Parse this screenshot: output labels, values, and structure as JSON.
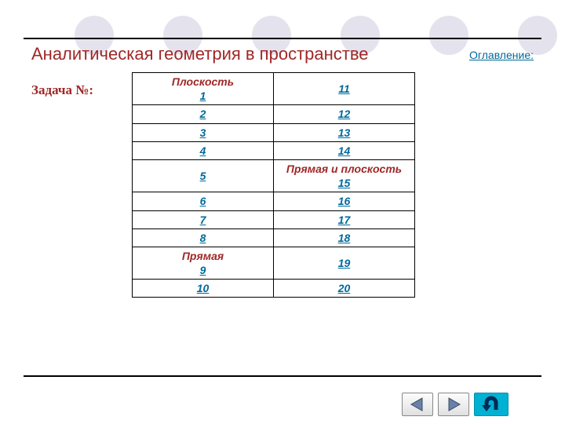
{
  "title": "Аналитическая геометрия в пространстве",
  "toc_link": "Оглавление:",
  "task_label": "Задача №:",
  "table": {
    "rows": [
      {
        "left_caption": "Плоскость",
        "left_num": "1",
        "right_caption": "",
        "right_num": "11"
      },
      {
        "left_caption": "",
        "left_num": "2",
        "right_caption": "",
        "right_num": "12"
      },
      {
        "left_caption": "",
        "left_num": "3",
        "right_caption": "",
        "right_num": "13"
      },
      {
        "left_caption": "",
        "left_num": "4",
        "right_caption": "",
        "right_num": "14"
      },
      {
        "left_caption": "",
        "left_num": "5",
        "right_caption": "Прямая и плоскость",
        "right_num": "15"
      },
      {
        "left_caption": "",
        "left_num": "6",
        "right_caption": "",
        "right_num": "16"
      },
      {
        "left_caption": "",
        "left_num": "7",
        "right_caption": "",
        "right_num": "17"
      },
      {
        "left_caption": "",
        "left_num": "8",
        "right_caption": "",
        "right_num": "18"
      },
      {
        "left_caption": "Прямая",
        "left_num": "9",
        "right_caption": "",
        "right_num": "19"
      },
      {
        "left_caption": "",
        "left_num": "10",
        "right_caption": "",
        "right_num": "20"
      }
    ]
  },
  "nav": {
    "prev": "previous",
    "next": "next",
    "return": "return"
  },
  "colors": {
    "heading": "#a02727",
    "link": "#006a9b",
    "circle": "#e4e3ed",
    "u_btn": "#00b1d4"
  }
}
